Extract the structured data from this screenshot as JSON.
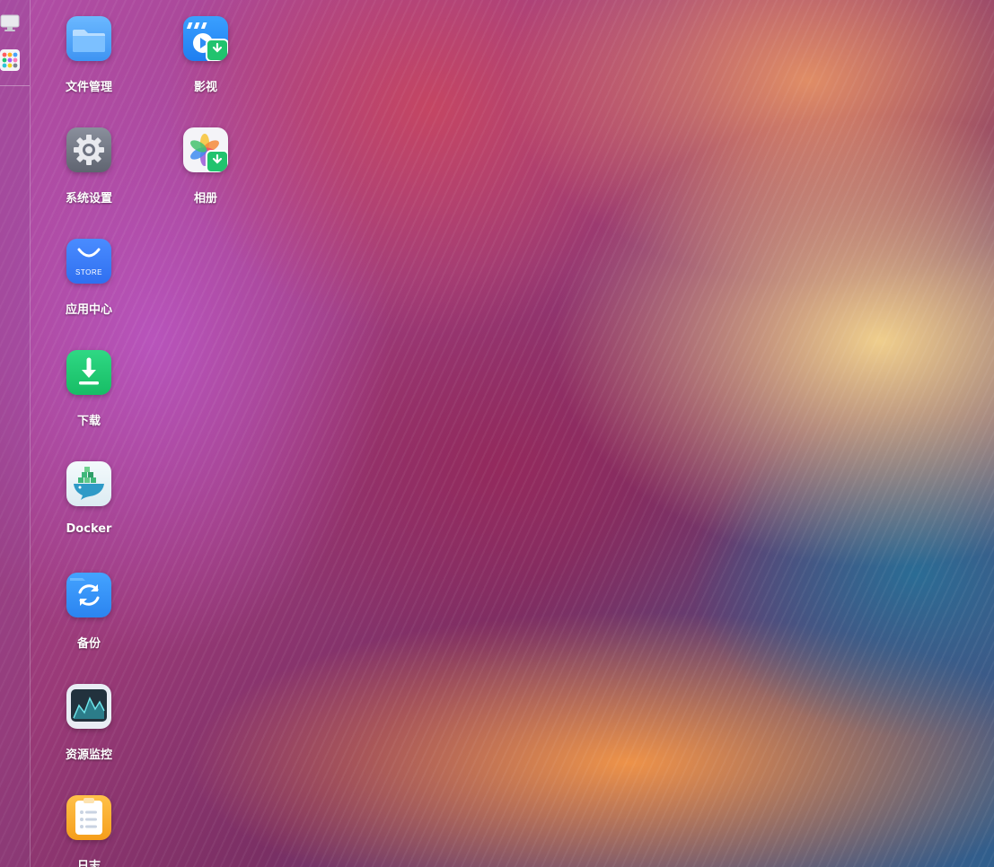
{
  "dock": {
    "items": [
      {
        "name": "monitor",
        "icon": "monitor-icon"
      },
      {
        "name": "launcher",
        "icon": "app-grid-icon"
      }
    ]
  },
  "apps": [
    {
      "label": "文件管理",
      "icon": "folder-icon",
      "color": "#4aa2f6"
    },
    {
      "label": "影视",
      "icon": "video-play-icon",
      "color": "#2f8df5"
    },
    {
      "label": "系统设置",
      "icon": "gear-icon",
      "color": "#7c8190"
    },
    {
      "label": "相册",
      "icon": "photos-pinwheel-icon",
      "color": "#f2f2f7"
    },
    {
      "label": "应用中心",
      "icon": "store-bag-icon",
      "color": "#3b7bf6"
    },
    {
      "label": "下载",
      "icon": "download-arrow-icon",
      "color": "#1fcf74"
    },
    {
      "label": "Docker",
      "icon": "docker-whale-icon",
      "color": "#e9f3f7"
    },
    {
      "label": "备份",
      "icon": "backup-sync-icon",
      "color": "#2f8df5"
    },
    {
      "label": "资源监控",
      "icon": "resource-monitor-icon",
      "color": "#2a3b48"
    },
    {
      "label": "日志",
      "icon": "notes-icon",
      "color": "#f5a623"
    }
  ]
}
